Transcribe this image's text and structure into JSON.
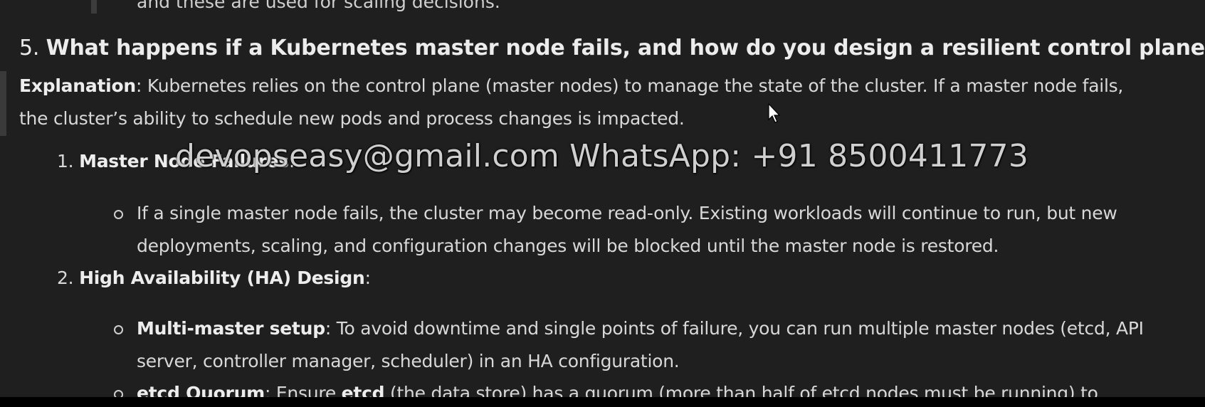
{
  "top": {
    "line": "and these are used for scaling decisions."
  },
  "question": {
    "number": "5.",
    "title": "What happens if a Kubernetes master node fails, and how do you design a resilient control plane?"
  },
  "explanation": {
    "label": "Explanation",
    "line1_rest": ": Kubernetes relies on the control plane (master nodes) to manage the state of the cluster. If a master node fails,",
    "line2": "the cluster’s ability to schedule new pods and process changes is impacted."
  },
  "items": [
    {
      "number": "1.",
      "title": "Master Node Failures",
      "suffix": ":",
      "bullets": [
        {
          "line1": "If a single master node fails, the cluster may become read-only. Existing workloads will continue to run, but new",
          "line2": "deployments, scaling, and configuration changes will be blocked until the master node is restored."
        }
      ]
    },
    {
      "number": "2.",
      "title": "High Availability (HA) Design",
      "suffix": ":",
      "bullets": [
        {
          "bold": "Multi-master setup",
          "line1_rest": ": To avoid downtime and single points of failure, you can run multiple master nodes (etcd, API",
          "line2": "server, controller manager, scheduler) in an HA configuration."
        },
        {
          "bold": "etcd Quorum",
          "mid1": ": Ensure ",
          "bold2": "etcd",
          "rest": " (the data store) has a quorum (more than half of etcd nodes must be running) to"
        }
      ]
    }
  ],
  "watermark": {
    "text": "devopseasy@gmail.com WhatsApp: +91 8500411773"
  },
  "colors": {
    "background": "#1f1f1f",
    "text": "#d8d8d8",
    "heading": "#ececec"
  }
}
